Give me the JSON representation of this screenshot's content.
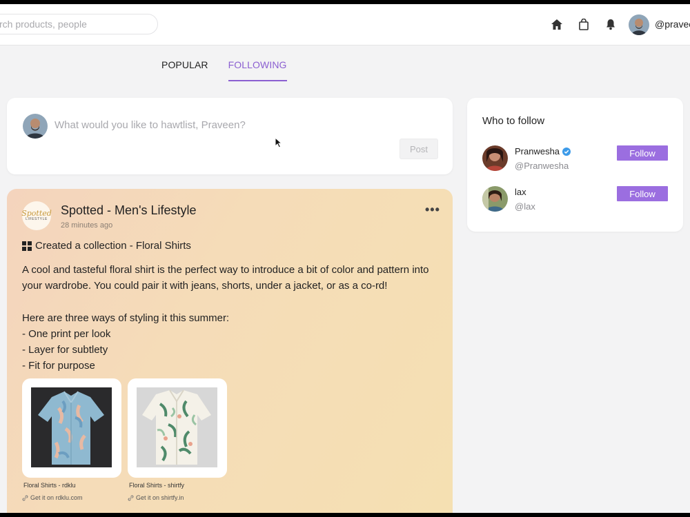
{
  "search": {
    "placeholder": "rch products, people"
  },
  "header": {
    "username": "@pravee"
  },
  "tabs": [
    {
      "label": "POPULAR",
      "active": false
    },
    {
      "label": "FOLLOWING",
      "active": true
    }
  ],
  "composer": {
    "placeholder": "What would you like to hawtlist, Praveen?",
    "post_label": "Post"
  },
  "post": {
    "brand_logo_text": "Spotted",
    "brand_logo_sub": "LIFESTYLE",
    "author": "Spotted - Men's Lifestyle",
    "time": "28 minutes ago",
    "collection": "Created a collection - Floral Shirts",
    "body": "A cool and tasteful floral shirt is the perfect way to introduce a bit of color and pattern into your wardrobe. You could pair it with jeans, shorts, under a jacket, or as a co-rd!\n\nHere are three ways of styling it this summer:\n- One print per look\n- Layer for subtlety\n- Fit for purpose",
    "products": [
      {
        "name": "Floral Shirts - rdklu",
        "link": "Get it on rdklu.com"
      },
      {
        "name": "Floral Shirts - shirtfy",
        "link": "Get it on shirtfy.in"
      }
    ]
  },
  "who_to_follow": {
    "title": "Who to follow",
    "users": [
      {
        "name": "Pranwesha",
        "handle": "@Pranwesha",
        "verified": true,
        "button": "Follow"
      },
      {
        "name": "lax",
        "handle": "@lax",
        "verified": false,
        "button": "Follow"
      }
    ]
  },
  "colors": {
    "accent": "#8b5fd1",
    "follow_button": "#9b6ee0",
    "verified": "#3d9be9"
  },
  "icons": [
    "home-icon",
    "shopping-bag-icon",
    "bell-icon",
    "grid-icon",
    "link-icon",
    "more-icon",
    "verified-icon",
    "cursor-icon"
  ]
}
